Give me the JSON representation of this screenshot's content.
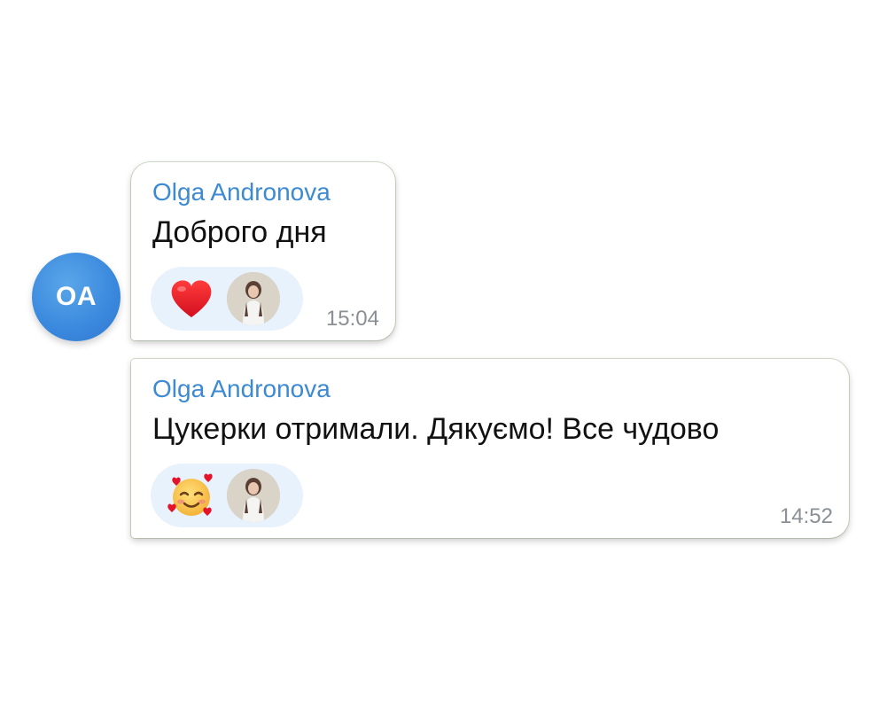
{
  "avatar": {
    "initials": "OA",
    "color": "#3a88dd"
  },
  "messages": [
    {
      "sender": "Olga Andronova",
      "text": "Доброго дня",
      "time": "15:04",
      "reaction": {
        "emoji": "red-heart",
        "reactor": "user-avatar-photo"
      }
    },
    {
      "sender": "Olga Andronova",
      "text": "Цукерки отримали. Дякуємо! Все чудово",
      "time": "14:52",
      "reaction": {
        "emoji": "smiling-face-with-hearts",
        "reactor": "user-avatar-photo"
      }
    }
  ],
  "colors": {
    "sender_name": "#3c8ad3",
    "reaction_pill": "#e8f2fc",
    "timestamp": "#8a8f96"
  }
}
